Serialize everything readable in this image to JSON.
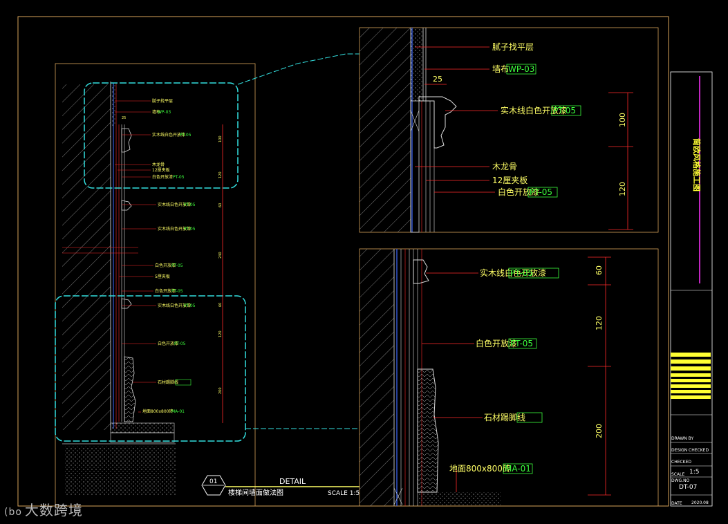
{
  "colors": {
    "background": "#000000",
    "label": "#ffff66",
    "code": "#3cff3c",
    "leader": "#ff2a2a",
    "frame": "#d9a35a",
    "cyan": "#33e0e0",
    "wall": "#aaaaaa"
  },
  "zoom_top": {
    "labels": [
      "腻子找平层",
      "墙布",
      "实木线白色开放漆",
      "木龙骨",
      "12厘夹板",
      "白色开放漆"
    ],
    "codes": [
      "WP-03",
      "PT-05",
      "PT-05"
    ],
    "dims": [
      "25",
      "100",
      "120"
    ]
  },
  "zoom_bottom": {
    "labels": [
      "实木线白色开放漆",
      "白色开放漆",
      "石材踢脚线",
      "地面800x800砖"
    ],
    "codes": [
      "PT-05",
      "PT-05",
      "MA-01"
    ],
    "dims": [
      "60",
      "120",
      "200"
    ]
  },
  "main": {
    "labels": [
      "腻子找平层",
      "墙布",
      "实木线白色开放漆",
      "木龙骨",
      "12厘夹板",
      "白色开放漆",
      "实木线白色开放漆",
      "实木线白色开放漆",
      "白色开放漆",
      "5厘夹板",
      "白色开放漆",
      "实木线白色开放漆",
      "白色开放漆",
      "石材踢脚线",
      "地面800x800砖"
    ],
    "codes": [
      "WP-03",
      "PT-05",
      "PT-05",
      "PT-05",
      "PT-05",
      "PT-05",
      "PT-05",
      "PT-05",
      "PT-05",
      "MA-01"
    ],
    "dims": [
      "25",
      "100",
      "120",
      "60",
      "240",
      "60",
      "120",
      "200"
    ]
  },
  "detail": {
    "number": "01",
    "heading": "DETAIL",
    "name": "楼梯间墙面做法图",
    "scale": "SCALE 1:5"
  },
  "title_block": {
    "project": "简欧风格施工图",
    "labels": [
      "DRAWN BY",
      "DESIGN CHECKED",
      "CHECKED",
      "SCALE",
      "DWG.NO",
      "DATE"
    ],
    "scale": "1:5",
    "dwg_no": "DT-07",
    "date": "2020.08"
  },
  "watermark": "大数跨境"
}
